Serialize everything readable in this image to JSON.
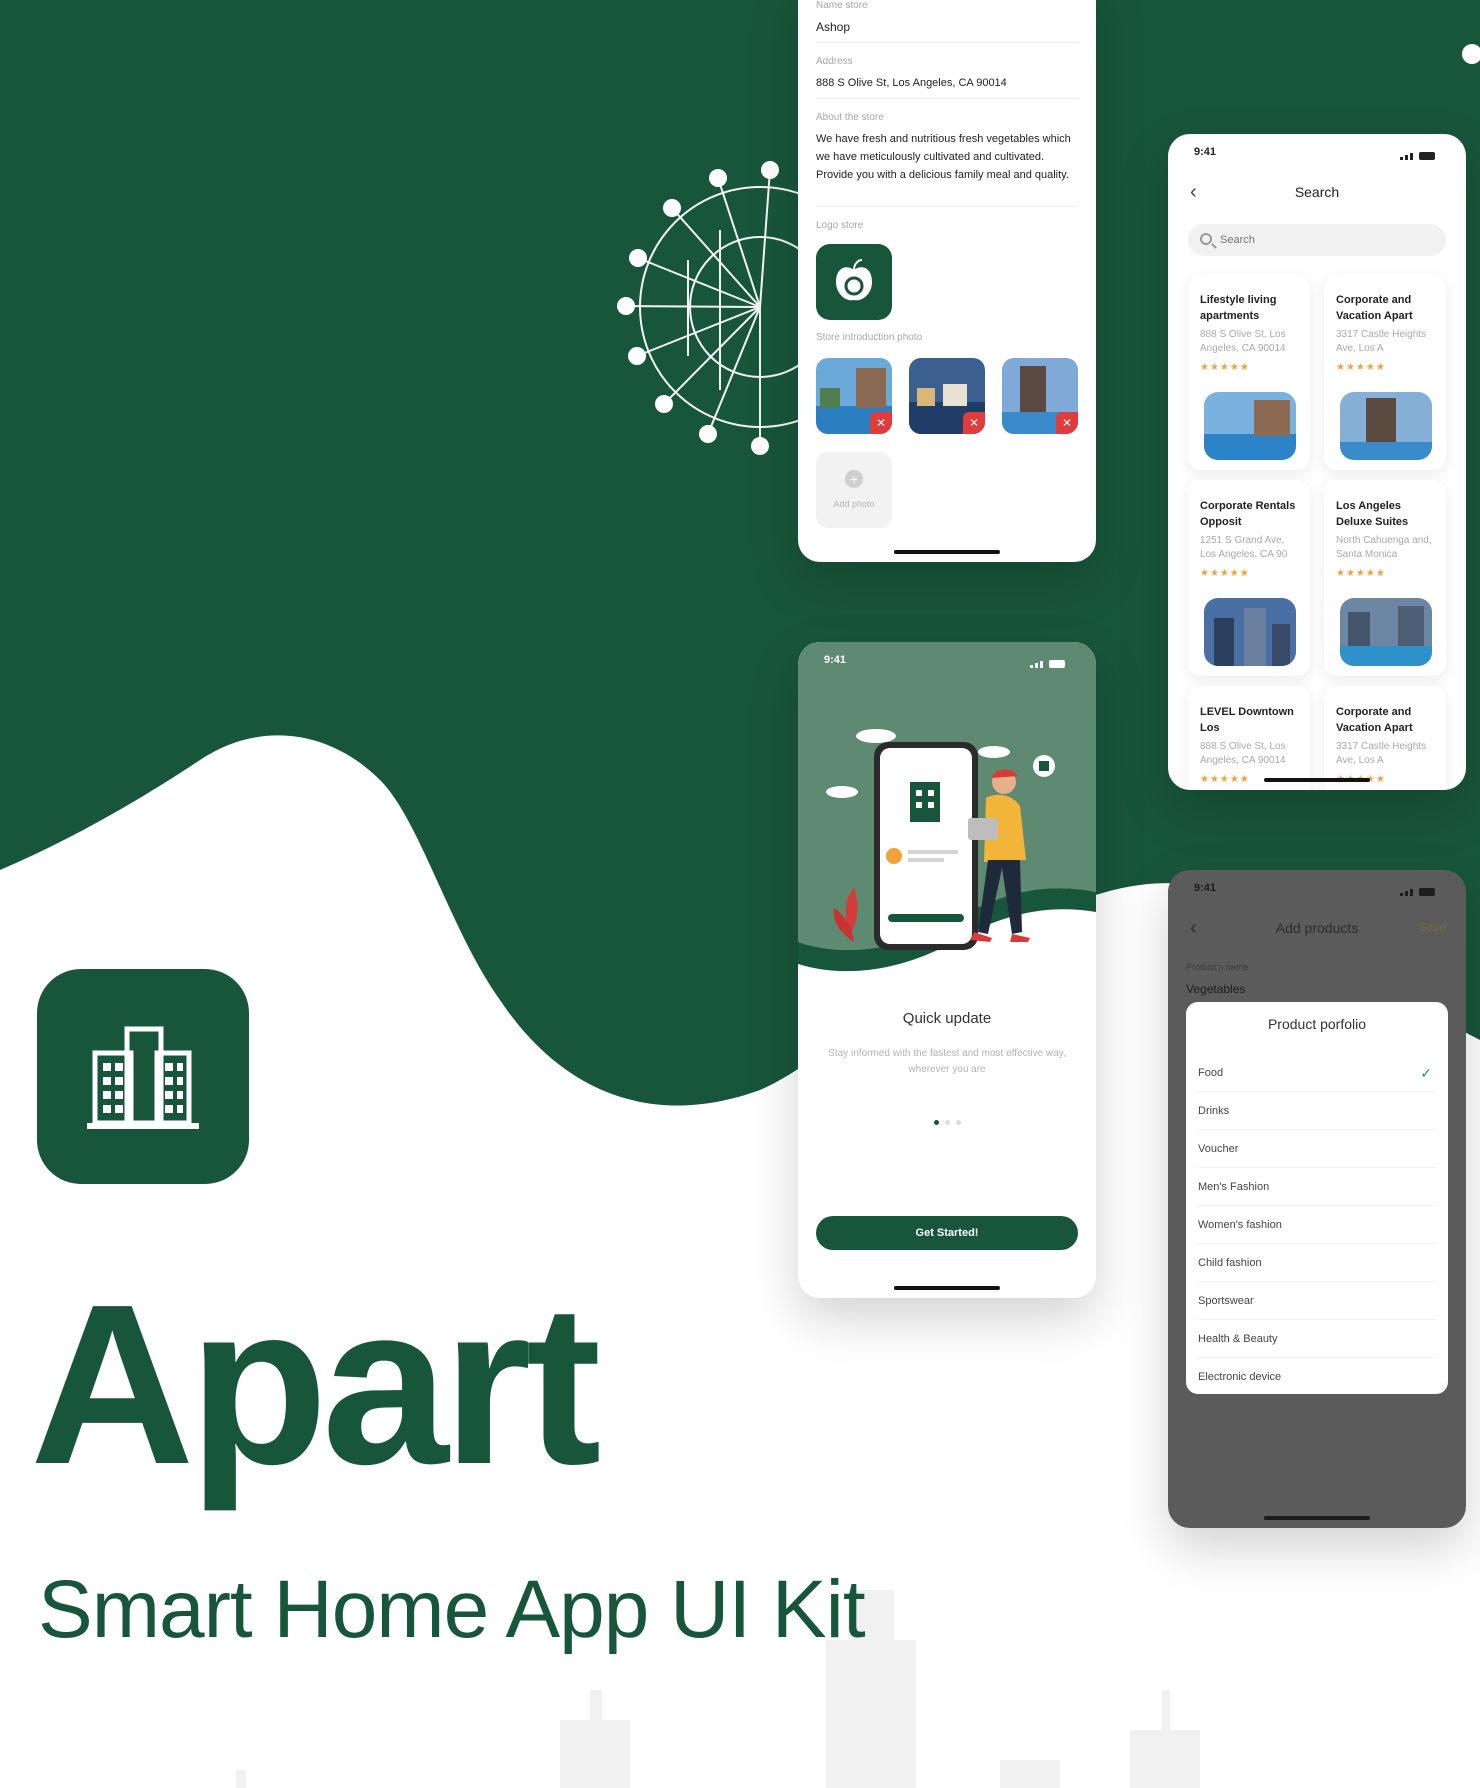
{
  "colors": {
    "brand_green": "#18563b",
    "accent_orange": "#f2a23a",
    "danger_red": "#e23b3b"
  },
  "branding": {
    "name": "Apart",
    "tagline": "Smart Home App UI Kit",
    "icon": "buildings-icon"
  },
  "store_form": {
    "name_label": "Name store",
    "name_value": "Ashop",
    "address_label": "Address",
    "address_value": "888 S Olive St, Los Angeles, CA 90014",
    "about_label": "About the store",
    "about_value": "We have fresh and nutritious fresh vegetables which we have meticulously cultivated and cultivated. Provide you with a delicious family meal and quality.",
    "logo_label": "Logo store",
    "photos_label": "Store introduction photo",
    "add_photo_label": "Add photo",
    "remove_icon": "close-icon"
  },
  "search_screen": {
    "time": "9:41",
    "title": "Search",
    "placeholder": "Search",
    "results": [
      {
        "title": "Lifestyle living apartments",
        "address": "888 S Olive St, Los Angeles, CA 90014",
        "rating": "★★★★★"
      },
      {
        "title": "Corporate and Vacation Apart",
        "address": "3317 Castle Heights Ave, Los A",
        "rating": "★★★★★"
      },
      {
        "title": "Corporate Rentals Opposit",
        "address": "1251 S Grand Ave, Los Angeles, CA 90",
        "rating": "★★★★★"
      },
      {
        "title": "Los Angeles Deluxe Suites",
        "address": "North Cahuenga and, Santa Monica",
        "rating": "★★★★★"
      },
      {
        "title": "LEVEL Downtown Los",
        "address": "888 S Olive St, Los Angeles, CA 90014",
        "rating": "★★★★★"
      },
      {
        "title": "Corporate and Vacation Apart",
        "address": "3317 Castle Heights Ave, Los A",
        "rating": "★★★★★"
      }
    ]
  },
  "onboarding": {
    "time": "9:41",
    "title": "Quick update",
    "description": "Stay informed with the fastest and most effective way, wherever you are",
    "button": "Get Started!"
  },
  "add_products": {
    "time": "9:41",
    "title": "Add products",
    "save": "Save",
    "name_label": "Product's name",
    "name_value": "Vegetables",
    "modal_title": "Product porfolio",
    "options": [
      "Food",
      "Drinks",
      "Voucher",
      "Men's Fashion",
      "Women's fashion",
      "Child fashion",
      "Sportswear",
      "Health & Beauty",
      "Electronic device"
    ],
    "selected": "Food",
    "check_icon": "check-icon"
  }
}
